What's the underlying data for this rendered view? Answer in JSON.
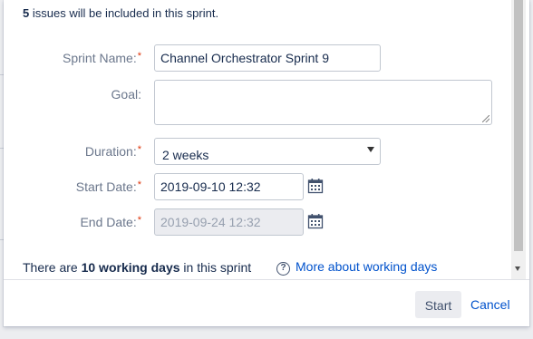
{
  "dialog": {
    "issues_count": "5",
    "issues_text": "issues will be included in this sprint."
  },
  "form": {
    "sprint_name": {
      "label": "Sprint Name:",
      "value": "Channel Orchestrator Sprint 9",
      "required": true
    },
    "goal": {
      "label": "Goal:",
      "value": ""
    },
    "duration": {
      "label": "Duration:",
      "value": "2 weeks",
      "required": true
    },
    "start_date": {
      "label": "Start Date:",
      "value": "2019-09-10 12:32",
      "required": true
    },
    "end_date": {
      "label": "End Date:",
      "value": "2019-09-24 12:32",
      "required": true,
      "disabled": true
    },
    "required_marker": "*"
  },
  "info": {
    "working_prefix": "There are",
    "working_bold": "10 working days",
    "working_suffix": "in this sprint",
    "help_link": "More about working days",
    "help_icon": "?"
  },
  "footer": {
    "start_label": "Start",
    "cancel_label": "Cancel"
  },
  "icons": {
    "calendar": "calendar-icon",
    "help": "question-circle-icon",
    "dropdown": "chevron-down-icon"
  },
  "colors": {
    "link": "#0052cc",
    "required": "#de350b",
    "label": "#6b778c",
    "text": "#172b4d"
  }
}
